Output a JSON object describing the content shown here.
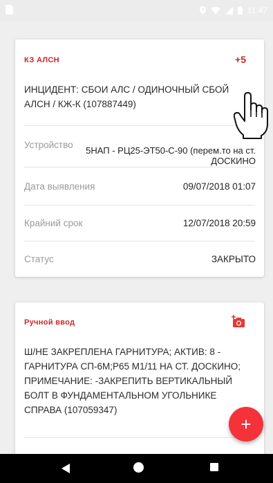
{
  "status_bar": {
    "time": "11:47"
  },
  "card1": {
    "tag": "КЗ АЛСН",
    "count": "+5",
    "description": "ИНЦИДЕНТ: СБОИ АЛС / ОДИНОЧНЫЙ СБОЙ АЛСН / КЖ-К (107887449)",
    "rows": [
      {
        "label": "Устройство",
        "value": "5НАП - РЦ25-ЭТ50-С-90 (перем.то на ст. ДОСКИНО"
      },
      {
        "label": "Дата выявления",
        "value": "09/07/2018 01:07"
      },
      {
        "label": "Крайний срок",
        "value": "12/07/2018 20:59"
      },
      {
        "label": "Статус",
        "value": "ЗАКРЫТО"
      }
    ]
  },
  "card2": {
    "tag": "Ручной ввод",
    "description": "Ш/НЕ ЗАКРЕПЛЕНА ГАРНИТУРА; АКТИВ: 8 - ГАРНИТУРА СП-6М;Р65 М1/11 НА СТ. ДОСКИНО; ПРИМЕЧАНИЕ: -ЗАКРЕПИТЬ ВЕРТИКАЛЬНЫЙ БОЛТ В ФУНДАМЕНТАЛЬНОМ УГОЛЬНИКЕ СПРАВА (107059347)"
  },
  "fab": {
    "label": "+"
  },
  "icons": {
    "camera": "add-photo-icon",
    "fab": "plus-icon",
    "cursor": "hand-pointer-icon"
  },
  "colors": {
    "accent": "#c62828",
    "fab": "#f4323a"
  }
}
